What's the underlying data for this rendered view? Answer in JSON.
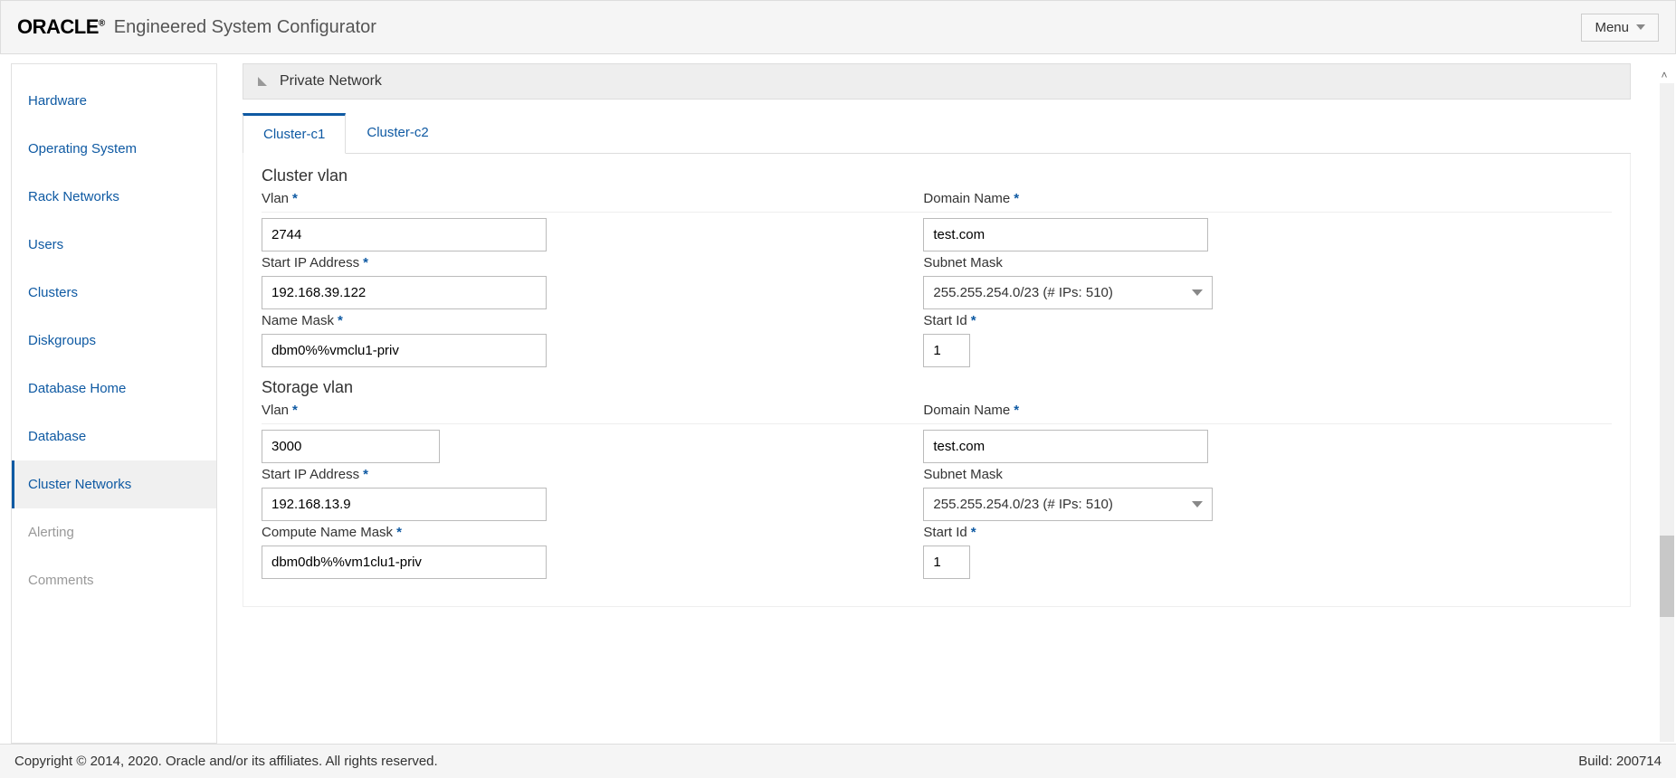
{
  "header": {
    "logo_text": "ORACLE",
    "app_title": "Engineered System Configurator",
    "menu_label": "Menu"
  },
  "sidebar": {
    "items": [
      {
        "label": "Hardware",
        "active": false,
        "disabled": false
      },
      {
        "label": "Operating System",
        "active": false,
        "disabled": false
      },
      {
        "label": "Rack Networks",
        "active": false,
        "disabled": false
      },
      {
        "label": "Users",
        "active": false,
        "disabled": false
      },
      {
        "label": "Clusters",
        "active": false,
        "disabled": false
      },
      {
        "label": "Diskgroups",
        "active": false,
        "disabled": false
      },
      {
        "label": "Database Home",
        "active": false,
        "disabled": false
      },
      {
        "label": "Database",
        "active": false,
        "disabled": false
      },
      {
        "label": "Cluster Networks",
        "active": true,
        "disabled": false
      },
      {
        "label": "Alerting",
        "active": false,
        "disabled": true
      },
      {
        "label": "Comments",
        "active": false,
        "disabled": true
      }
    ]
  },
  "panel": {
    "title": "Private Network",
    "tabs": [
      {
        "label": "Cluster-c1",
        "active": true
      },
      {
        "label": "Cluster-c2",
        "active": false
      }
    ]
  },
  "form": {
    "cluster_vlan": {
      "title": "Cluster vlan",
      "vlan_label": "Vlan",
      "vlan_value": "2744",
      "domain_label": "Domain Name",
      "domain_value": "test.com",
      "startip_label": "Start IP Address",
      "startip_value": "192.168.39.122",
      "subnet_label": "Subnet Mask",
      "subnet_value": "255.255.254.0/23 (# IPs: 510)",
      "namemask_label": "Name Mask",
      "namemask_value": "dbm0%%vmclu1-priv",
      "startid_label": "Start Id",
      "startid_value": "1"
    },
    "storage_vlan": {
      "title": "Storage vlan",
      "vlan_label": "Vlan",
      "vlan_value": "3000",
      "domain_label": "Domain Name",
      "domain_value": "test.com",
      "startip_label": "Start IP Address",
      "startip_value": "192.168.13.9",
      "subnet_label": "Subnet Mask",
      "subnet_value": "255.255.254.0/23 (# IPs: 510)",
      "compute_namemask_label": "Compute Name Mask",
      "compute_namemask_value": "dbm0db%%vm1clu1-priv",
      "startid_label": "Start Id",
      "startid_value": "1"
    }
  },
  "footer": {
    "copyright": "Copyright © 2014, 2020. Oracle and/or its affiliates. All rights reserved.",
    "build": "Build: 200714"
  }
}
